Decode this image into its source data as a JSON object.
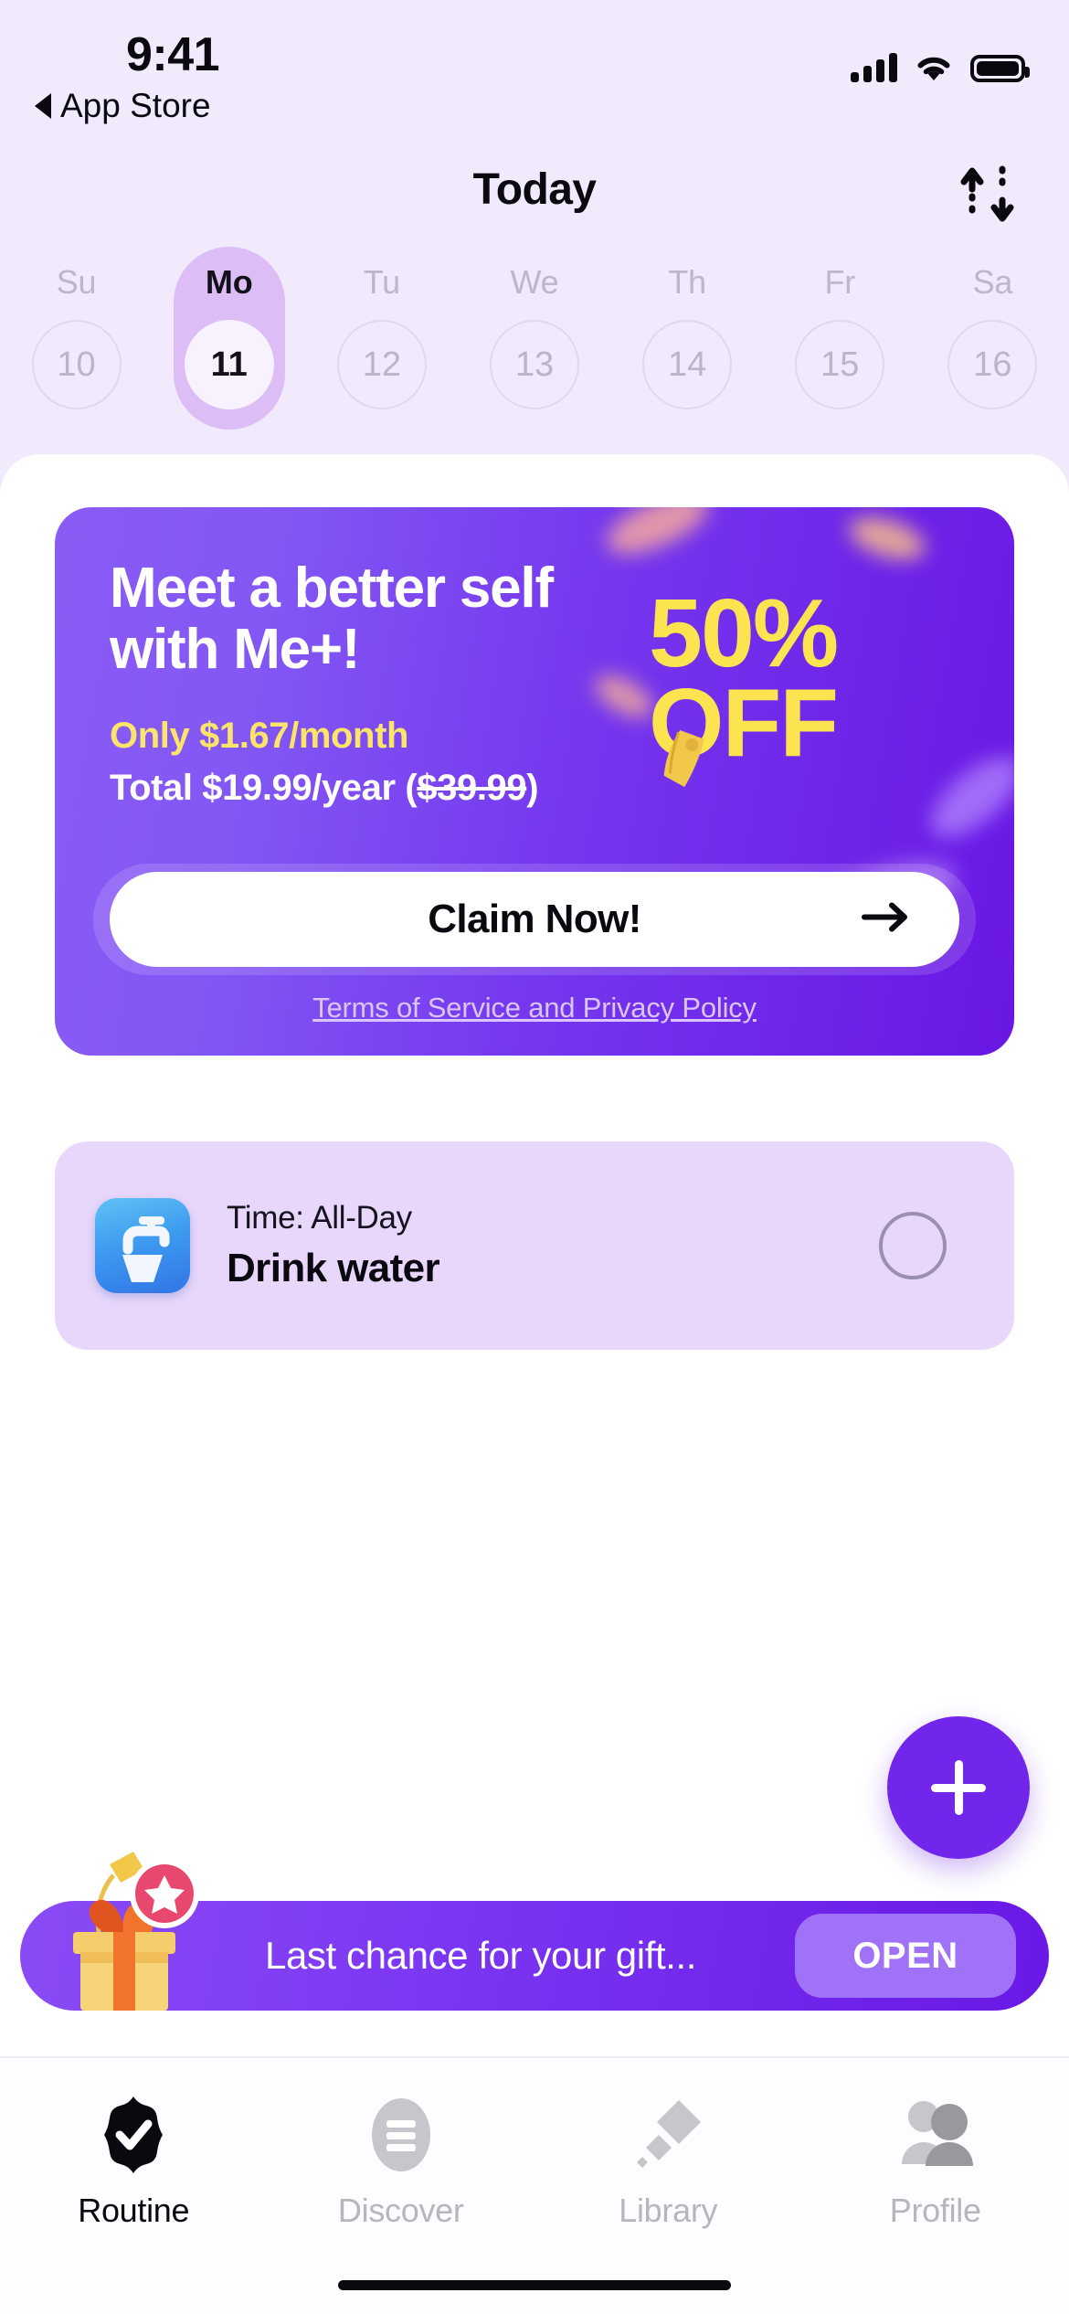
{
  "status_bar": {
    "time": "9:41",
    "back_label": "App Store",
    "back_icon": "triangle-left-icon",
    "signal_icon": "cellular-signal-icon",
    "wifi_icon": "wifi-icon",
    "battery_icon": "battery-full-icon"
  },
  "navbar": {
    "title": "Today",
    "sort_icon": "sort-up-down-icon"
  },
  "week": {
    "days": [
      {
        "dow": "Su",
        "num": "10",
        "selected": false
      },
      {
        "dow": "Mo",
        "num": "11",
        "selected": true
      },
      {
        "dow": "Tu",
        "num": "12",
        "selected": false
      },
      {
        "dow": "We",
        "num": "13",
        "selected": false
      },
      {
        "dow": "Th",
        "num": "14",
        "selected": false
      },
      {
        "dow": "Fr",
        "num": "15",
        "selected": false
      },
      {
        "dow": "Sa",
        "num": "16",
        "selected": false
      }
    ]
  },
  "promo": {
    "headline": "Meet a better self with Me+!",
    "price_line": "Only $1.67/month",
    "total_prefix": "Total $19.99/year (",
    "total_strike": "$39.99",
    "total_suffix": ")",
    "discount_top": "50%",
    "discount_bottom": "OFF",
    "cta_label": "Claim Now!",
    "cta_arrow_icon": "arrow-right-icon",
    "terms_label": "Terms of Service and Privacy Policy",
    "tag_icon": "price-tag-icon",
    "accent_yellow": "#FBE44F",
    "gradient_from": "#8B5CF6",
    "gradient_to": "#6A16E4"
  },
  "task": {
    "icon_name": "faucet-water-icon",
    "time_label": "Time: All-Day",
    "title": "Drink water",
    "checkbox_icon": "checkbox-empty-circle-icon",
    "card_color": "#E8D7FB"
  },
  "fab": {
    "icon": "plus-icon",
    "color": "#7226EC"
  },
  "gift_banner": {
    "icon_name": "gift-box-icon",
    "badge_icon": "star-badge-icon",
    "message": "Last chance for your gift...",
    "button_label": "OPEN",
    "button_color": "#A072F7"
  },
  "tabbar": {
    "items": [
      {
        "label": "Routine",
        "icon": "rosette-check-icon",
        "active": true
      },
      {
        "label": "Discover",
        "icon": "list-oval-icon",
        "active": false
      },
      {
        "label": "Library",
        "icon": "diamond-stack-icon",
        "active": false
      },
      {
        "label": "Profile",
        "icon": "people-icon",
        "active": false
      }
    ]
  }
}
